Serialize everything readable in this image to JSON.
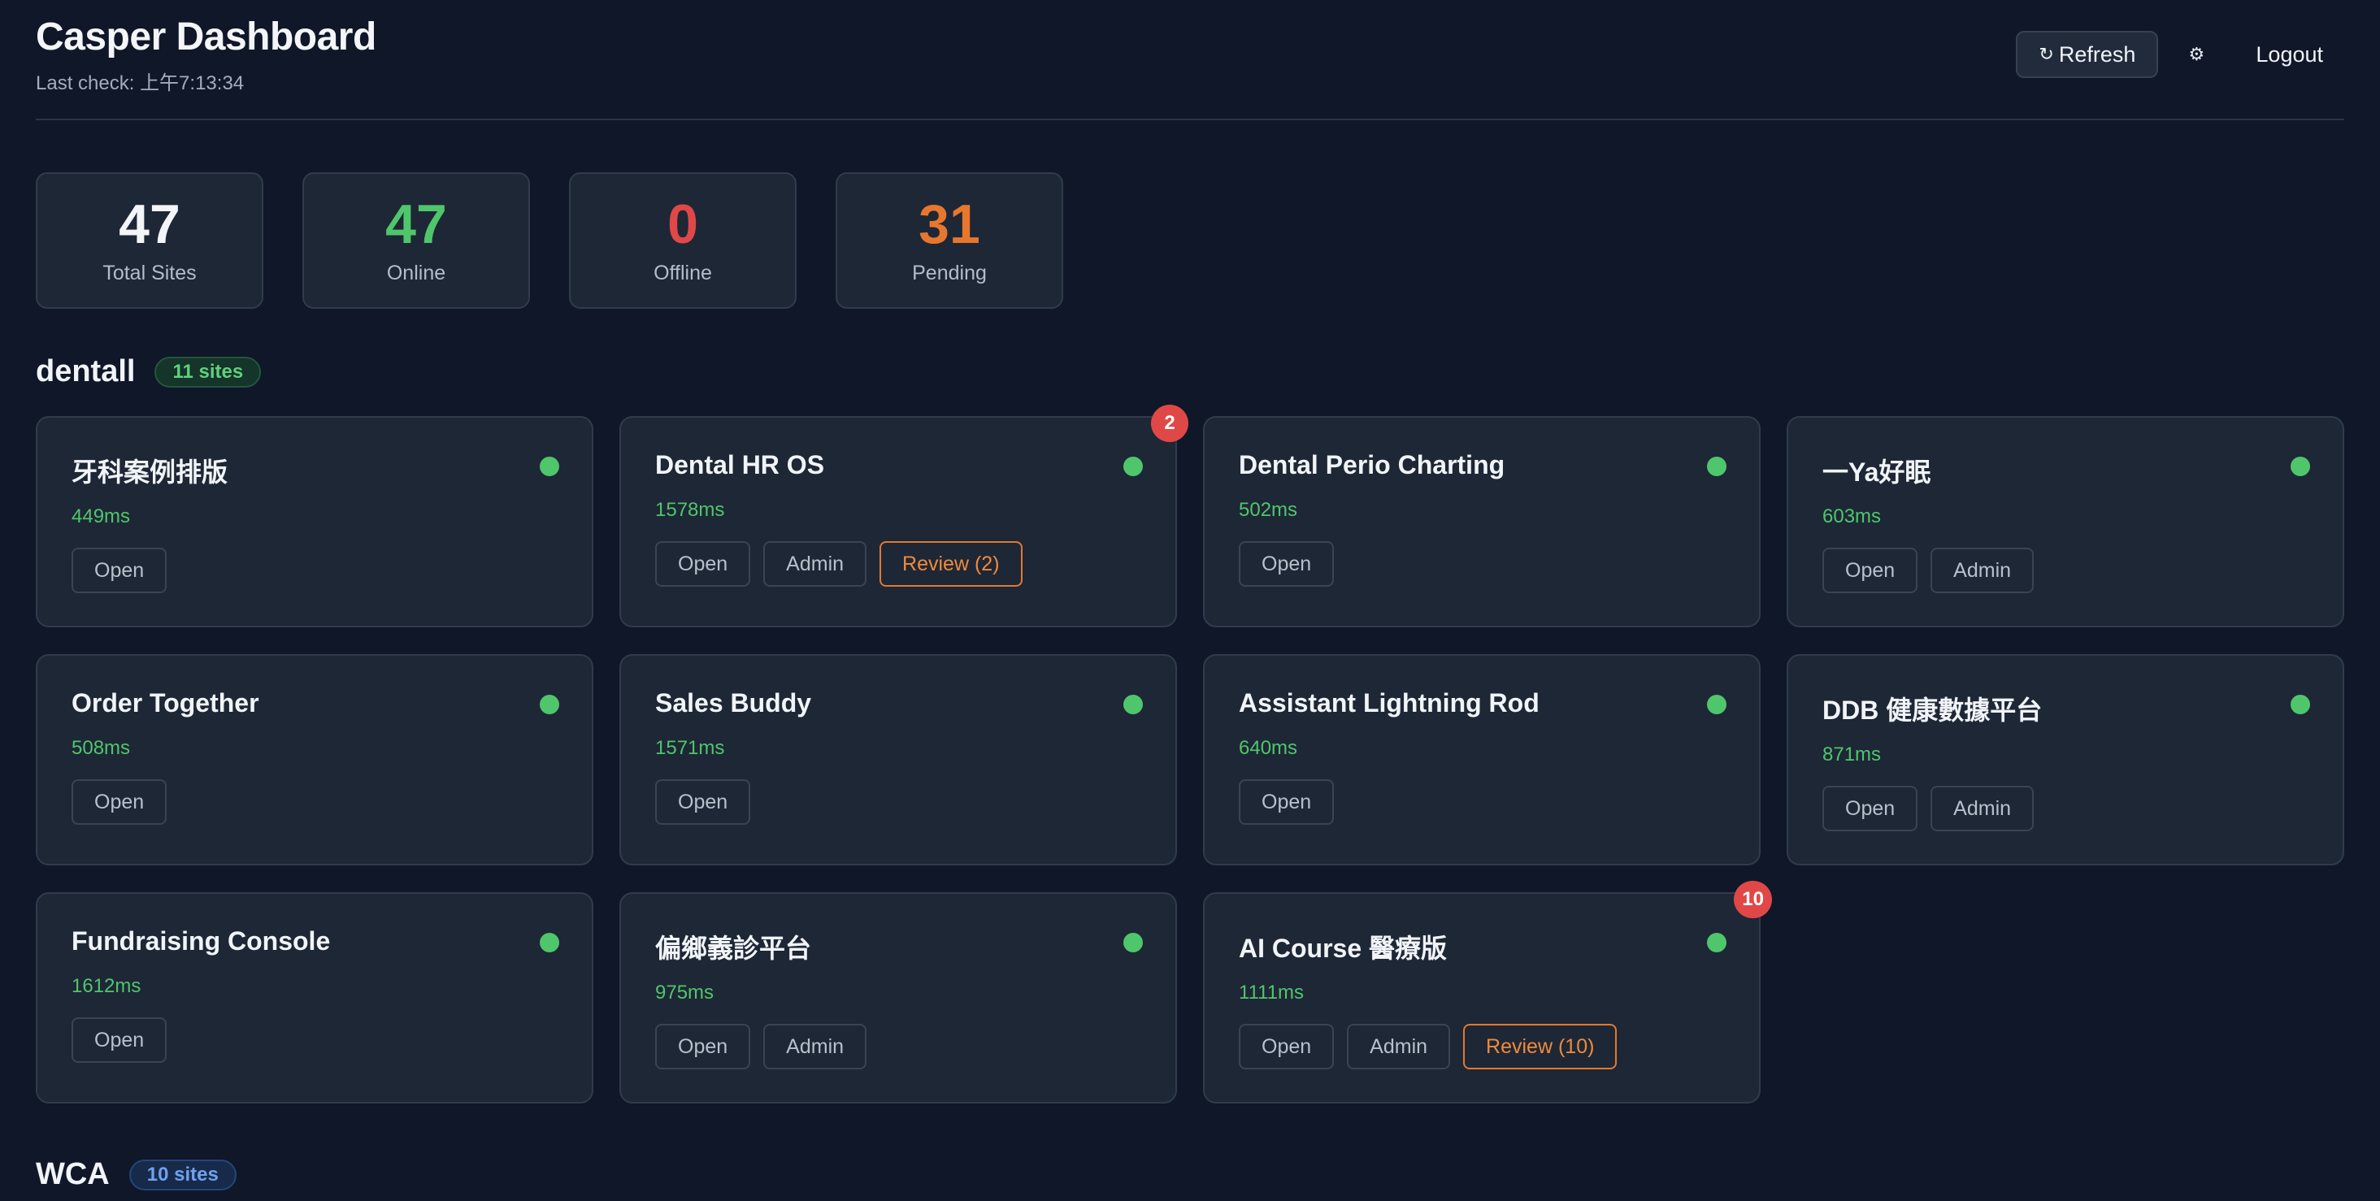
{
  "header": {
    "title": "Casper Dashboard",
    "last_check": "Last check: 上午7:13:34",
    "refresh_icon": "↻",
    "refresh_label": "Refresh",
    "settings_icon": "⚙",
    "logout_label": "Logout"
  },
  "stats": [
    {
      "value": "47",
      "label": "Total Sites",
      "color": "#f3f5f8"
    },
    {
      "value": "47",
      "label": "Online",
      "color": "#4fc66b"
    },
    {
      "value": "0",
      "label": "Offline",
      "color": "#e04848"
    },
    {
      "value": "31",
      "label": "Pending",
      "color": "#e8772e"
    }
  ],
  "groups": [
    {
      "name": "dentall",
      "count_label": "11 sites",
      "sites": [
        {
          "name": "牙科案例排版",
          "latency": "449ms",
          "actions": [
            "Open"
          ],
          "badge": null
        },
        {
          "name": "Dental HR OS",
          "latency": "1578ms",
          "actions": [
            "Open",
            "Admin",
            "Review (2)"
          ],
          "badge": "2"
        },
        {
          "name": "Dental Perio Charting",
          "latency": "502ms",
          "actions": [
            "Open"
          ],
          "badge": null
        },
        {
          "name": "一Ya好眠",
          "latency": "603ms",
          "actions": [
            "Open",
            "Admin"
          ],
          "badge": null
        },
        {
          "name": "Order Together",
          "latency": "508ms",
          "actions": [
            "Open"
          ],
          "badge": null
        },
        {
          "name": "Sales Buddy",
          "latency": "1571ms",
          "actions": [
            "Open"
          ],
          "badge": null
        },
        {
          "name": "Assistant Lightning Rod",
          "latency": "640ms",
          "actions": [
            "Open"
          ],
          "badge": null
        },
        {
          "name": "DDB 健康數據平台",
          "latency": "871ms",
          "actions": [
            "Open",
            "Admin"
          ],
          "badge": null
        },
        {
          "name": "Fundraising Console",
          "latency": "1612ms",
          "actions": [
            "Open"
          ],
          "badge": null
        },
        {
          "name": "偏鄉義診平台",
          "latency": "975ms",
          "actions": [
            "Open",
            "Admin"
          ],
          "badge": null
        },
        {
          "name": "AI Course 醫療版",
          "latency": "1111ms",
          "actions": [
            "Open",
            "Admin",
            "Review (10)"
          ],
          "badge": "10"
        }
      ]
    },
    {
      "name": "WCA",
      "count_label": "10 sites",
      "sites": []
    }
  ],
  "colors": {
    "background": "#0f1729",
    "card": "#1e2736",
    "online": "#4fc66b",
    "review_accent": "#e07a2f",
    "notification": "#e04848"
  }
}
